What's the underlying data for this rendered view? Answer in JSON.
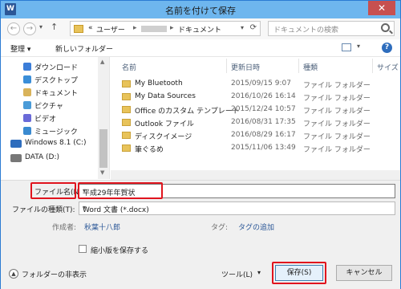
{
  "window": {
    "title": "名前を付けて保存",
    "app_icon_letter": "W",
    "close_glyph": "✕"
  },
  "nav": {
    "back_glyph": "←",
    "forward_glyph": "→",
    "history_glyph": "▾",
    "up_glyph": "↑",
    "address": {
      "prefix": "«",
      "crumb1": "ユーザー",
      "sep": "▸",
      "crumb2": "ドキュメント",
      "dropdown_glyph": "▾",
      "refresh_glyph": "⟳"
    },
    "search_placeholder": "ドキュメントの検索"
  },
  "toolbar": {
    "organize": "整理 ▾",
    "new_folder": "新しいフォルダー",
    "view_dropdown_glyph": "▾",
    "help": "?"
  },
  "sidebar": {
    "items": [
      {
        "label": "ダウンロード",
        "icon": "download-icon",
        "color": "#3b7dd8"
      },
      {
        "label": "デスクトップ",
        "icon": "desktop-icon",
        "color": "#3b8ed8"
      },
      {
        "label": "ドキュメント",
        "icon": "documents-icon",
        "color": "#d9b35a"
      },
      {
        "label": "ピクチャ",
        "icon": "pictures-icon",
        "color": "#4a9bd8"
      },
      {
        "label": "ビデオ",
        "icon": "videos-icon",
        "color": "#6a6ad8"
      },
      {
        "label": "ミュージック",
        "icon": "music-icon",
        "color": "#3a8ad0"
      },
      {
        "label": "Windows 8.1 (C:)",
        "icon": "windows-drive-icon",
        "color": "#2e6dbd"
      },
      {
        "label": "DATA (D:)",
        "icon": "drive-icon",
        "color": "#777777"
      }
    ]
  },
  "list": {
    "columns": {
      "name": "名前",
      "date": "更新日時",
      "type": "種類",
      "size": "サイズ"
    },
    "rows": [
      {
        "name": "My Bluetooth",
        "date": "2015/09/15 9:07",
        "type": "ファイル フォルダー"
      },
      {
        "name": "My Data Sources",
        "date": "2016/10/26 16:14",
        "type": "ファイル フォルダー"
      },
      {
        "name": "Office のカスタム テンプレート",
        "date": "2015/12/24 10:57",
        "type": "ファイル フォルダー"
      },
      {
        "name": "Outlook ファイル",
        "date": "2016/08/31 17:35",
        "type": "ファイル フォルダー"
      },
      {
        "name": "ディスクイメージ",
        "date": "2016/08/29 16:17",
        "type": "ファイル フォルダー"
      },
      {
        "name": "筆ぐるめ",
        "date": "2015/11/06 13:49",
        "type": "ファイル フォルダー"
      }
    ]
  },
  "form": {
    "filename_label": "ファイル名(N):",
    "filename_value": "平成29年年賀状",
    "filetype_label": "ファイルの種類(T):",
    "filetype_value": "Word 文書 (*.docx)",
    "dropdown_glyph": "▾",
    "author_label": "作成者:",
    "author_value": "秋葉十八郎",
    "tag_label": "タグ:",
    "tag_value": "タグの追加",
    "thumbnail_label": "縮小版を保存する"
  },
  "footer": {
    "hide_folders": "フォルダーの非表示",
    "hide_glyph": "▲",
    "tools": "ツール(L)",
    "tools_glyph": "▾",
    "save": "保存(S)",
    "cancel": "キャンセル"
  },
  "colors": {
    "title_bar": "#6eb6ee",
    "highlight": "#e0141e",
    "folder": "#e8c35a",
    "link": "#2b5797"
  }
}
